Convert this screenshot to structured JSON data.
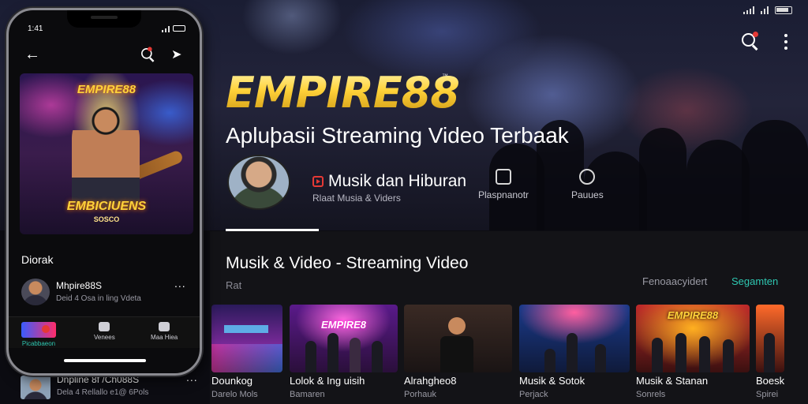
{
  "status_bar": {
    "phone_time": "1:41"
  },
  "header": {
    "brand": "EMPIRE88",
    "trademark": "™",
    "tagline": "Apluþasii Streaming Video Terbaak"
  },
  "channel": {
    "category_label": "Musik dan Hiburan",
    "category_sub": "Rlaat Musia & Viders",
    "stats": [
      {
        "label": "Plaspnanotr",
        "icon": "thumbs-up-icon"
      },
      {
        "label": "Pauues",
        "icon": "camera-icon"
      }
    ]
  },
  "section": {
    "title": "Musik & Video - Streaming Video",
    "subtitle": "Rat",
    "link_secondary": "Fenoaacyidert",
    "link_primary": "Segamten",
    "accent_color": "#2ec7b1"
  },
  "cards": [
    {
      "title": "Dounkog",
      "sub": "Darelo Mols",
      "thumb_text": ""
    },
    {
      "title": "Lolok & Ing uisih",
      "sub": "Bamaren",
      "thumb_text": "EMPIRE8"
    },
    {
      "title": "Alrahgheo8",
      "sub": "Porhauk",
      "thumb_text": ""
    },
    {
      "title": "Musik & Sotok",
      "sub": "Perjack",
      "thumb_text": ""
    },
    {
      "title": "Musik & Stanan",
      "sub": "Sonrels",
      "thumb_text": "EMPIRE88"
    },
    {
      "title": "Boesk",
      "sub": "Spirei",
      "thumb_text": ""
    }
  ],
  "phone": {
    "poster": {
      "brand": "EMPIRE88",
      "title": "EMBICIUENS",
      "sub": "SOSCO"
    },
    "section_label": "Diorak",
    "list_item": {
      "title": "Mhpire88S",
      "sub": "Deid 4 Osa in ling Vdeta",
      "more": "..."
    },
    "nav": [
      {
        "label": "Picabbaeon"
      },
      {
        "label": "Venees"
      },
      {
        "label": "Maa Hiea"
      }
    ]
  },
  "below_phone": {
    "title": "Dnpline 8f /Ch088S",
    "sub": "Dela 4 Rellallo e1@ 6Pols",
    "more": "..."
  }
}
